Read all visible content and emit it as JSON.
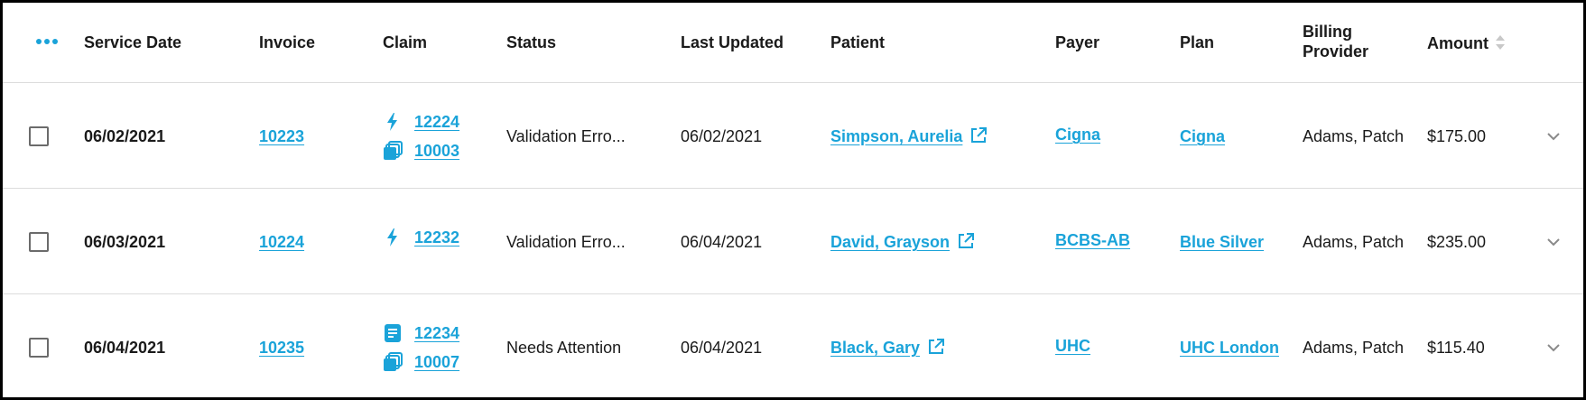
{
  "colors": {
    "accent": "#1aa3d9",
    "text": "#1a1a1a",
    "divider": "#dcdcdc",
    "checkbox_border": "#6b6b6b"
  },
  "header": {
    "menu_icon": "more-dots-icon",
    "columns": {
      "service_date": "Service Date",
      "invoice": "Invoice",
      "claim": "Claim",
      "status": "Status",
      "last_updated": "Last Updated",
      "patient": "Patient",
      "payer": "Payer",
      "plan": "Plan",
      "billing_provider_line1": "Billing",
      "billing_provider_line2": "Provider",
      "amount": "Amount"
    },
    "amount_sort_icon": "sort-arrows-icon"
  },
  "rows": [
    {
      "service_date": "06/02/2021",
      "invoice": "10223",
      "claims": [
        {
          "icon": "lightning-icon",
          "number": "12224"
        },
        {
          "icon": "copies-icon",
          "number": "10003"
        }
      ],
      "status": "Validation Erro...",
      "last_updated": "06/02/2021",
      "patient": "Simpson, Aurelia",
      "payer": "Cigna",
      "plan": "Cigna",
      "billing_provider": "Adams, Patch",
      "amount": "$175.00"
    },
    {
      "service_date": "06/03/2021",
      "invoice": "10224",
      "claims": [
        {
          "icon": "lightning-icon",
          "number": "12232"
        }
      ],
      "status": "Validation Erro...",
      "last_updated": "06/04/2021",
      "patient": "David, Grayson",
      "payer": "BCBS-AB",
      "plan": "Blue Silver",
      "billing_provider": "Adams, Patch",
      "amount": "$235.00"
    },
    {
      "service_date": "06/04/2021",
      "invoice": "10235",
      "claims": [
        {
          "icon": "document-icon",
          "number": "12234"
        },
        {
          "icon": "copies-icon",
          "number": "10007"
        }
      ],
      "status": "Needs Attention",
      "last_updated": "06/04/2021",
      "patient": "Black, Gary",
      "payer": "UHC",
      "plan": "UHC London",
      "billing_provider": "Adams, Patch",
      "amount": "$115.40"
    }
  ]
}
